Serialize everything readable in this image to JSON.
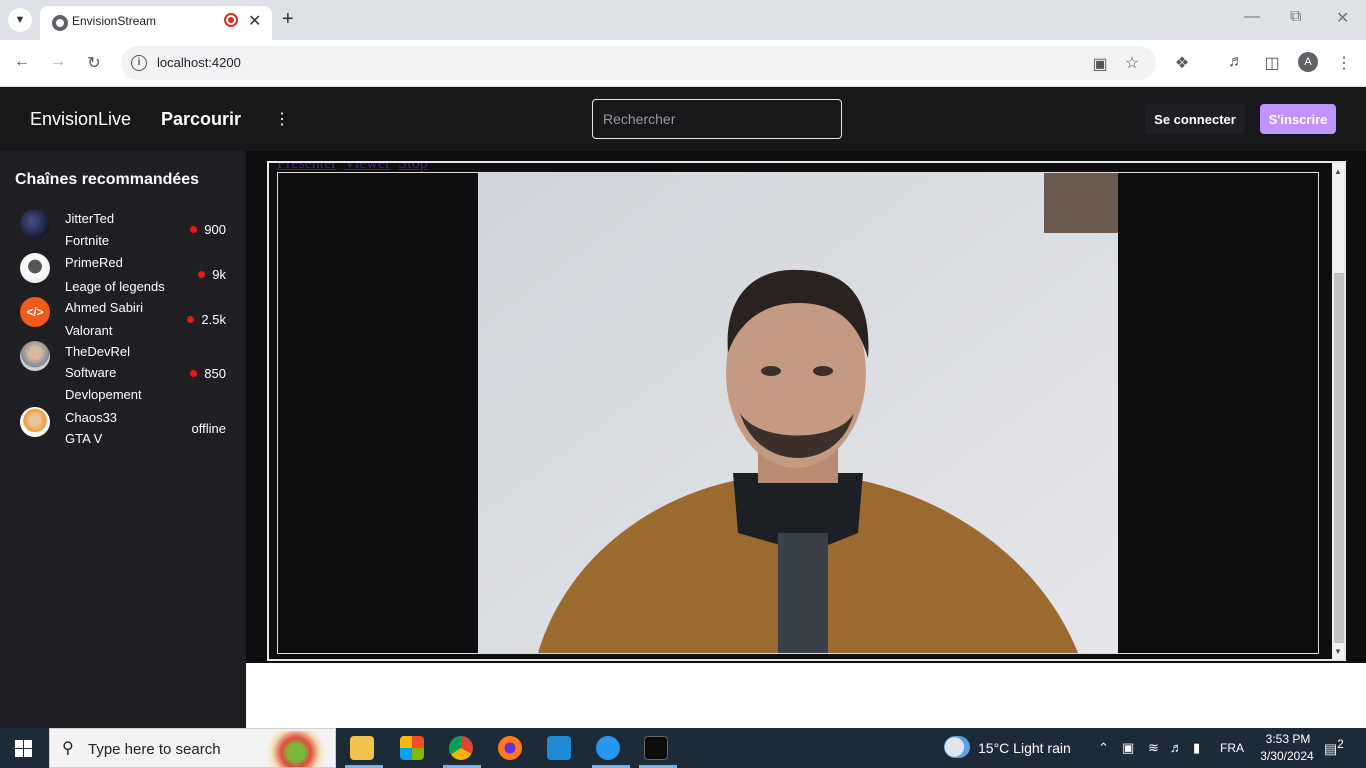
{
  "browser": {
    "tab_title": "EnvisionStream",
    "url": "localhost:4200",
    "profile_initial": "A"
  },
  "header": {
    "logo": "EnvisionLive",
    "browse": "Parcourir",
    "search_placeholder": "Rechercher",
    "login": "Se connecter",
    "signup": "S'inscrire",
    "accent_color": "#bf94ff"
  },
  "sidebar": {
    "title": "Chaînes recommandées",
    "channels": [
      {
        "name": "JitterTed",
        "game": "Fortnite",
        "viewers": "900",
        "live": true
      },
      {
        "name": "PrimeRed",
        "game": "Leage of legends",
        "viewers": "9k",
        "live": true
      },
      {
        "name": "Ahmed Sabiri",
        "game": "Valorant",
        "viewers": "2.5k",
        "live": true
      },
      {
        "name": "TheDevRel",
        "game": "Software Devlopement",
        "viewers": "850",
        "live": true
      },
      {
        "name": "Chaos33",
        "game": "GTA V",
        "viewers": "offline",
        "live": false
      }
    ]
  },
  "main": {
    "links": [
      "Presenter",
      "Viewer",
      "Stop"
    ]
  },
  "taskbar": {
    "search_placeholder": "Type here to search",
    "weather": "15°C  Light rain",
    "language": "FRA",
    "time": "3:53 PM",
    "date": "3/30/2024",
    "notifications": "2"
  }
}
